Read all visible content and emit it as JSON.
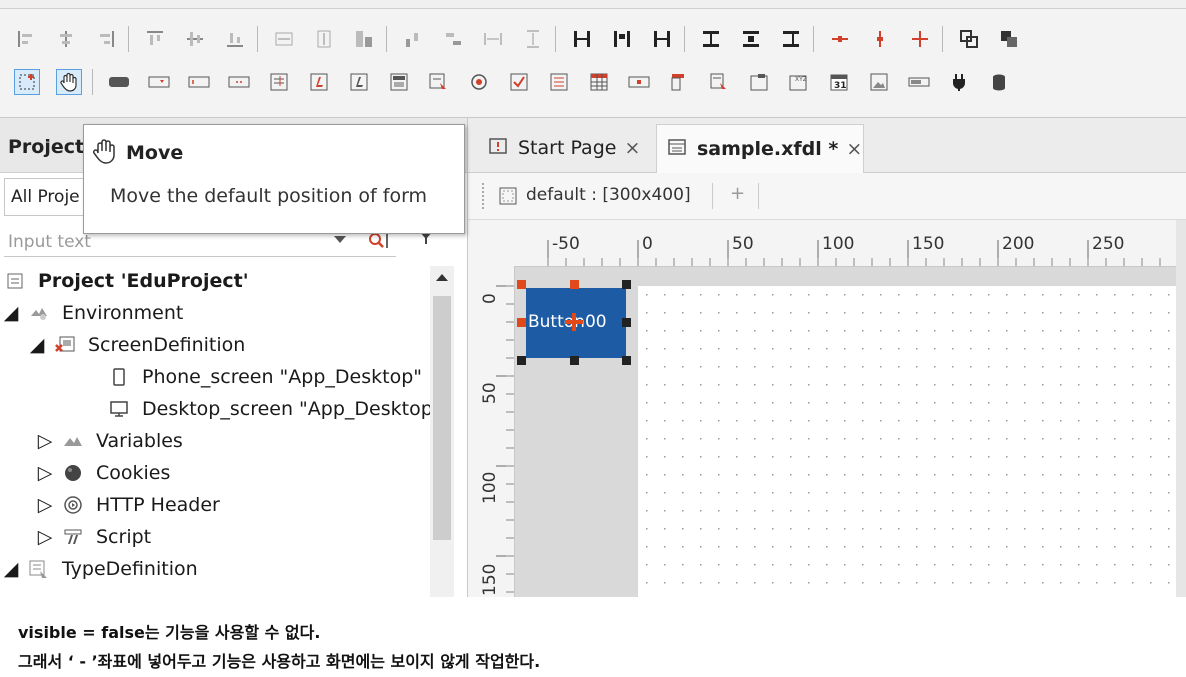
{
  "toolbar": {
    "row1_icons": [
      "align-left-icon",
      "align-center-icon",
      "align-right-icon",
      "align-top-icon",
      "align-middle-icon",
      "align-bottom-icon",
      "same-width-icon",
      "same-height-icon",
      "same-size-icon",
      "distribute-h-icon",
      "distribute-v-icon",
      "space-h-icon",
      "space-v-icon",
      "anchor-left-icon",
      "anchor-center-icon",
      "anchor-right-icon",
      "anchor-top-icon",
      "anchor-middle-icon",
      "anchor-bottom-icon",
      "shrink-h-icon",
      "grow-v-icon",
      "grow-all-icon",
      "bring-front-icon",
      "send-back-icon"
    ],
    "row2_icons": [
      "select-icon",
      "move-hand-icon",
      "button-comp-icon",
      "combo-comp-icon",
      "edit-comp-icon",
      "spin-comp-icon",
      "textarea-comp-icon",
      "label-comp-icon",
      "static-comp-icon",
      "calendar-comp-icon",
      "radio-comp-icon",
      "checkbox-comp-icon",
      "listbox-comp-icon",
      "grid-comp-icon",
      "maskedit-comp-icon",
      "menu-comp-icon",
      "tab-comp-icon",
      "div-comp-icon",
      "groupbox-comp-icon",
      "date-comp-icon",
      "image-comp-icon",
      "progress-comp-icon",
      "plugin-comp-icon",
      "dataset-comp-icon"
    ]
  },
  "project_panel": {
    "title": "Project",
    "combo_value": "All Proje",
    "search_placeholder": "Input text"
  },
  "tooltip": {
    "title": "Move",
    "description": "Move the default position of form"
  },
  "tree": [
    {
      "label": "Project 'EduProject'",
      "icon": "project-icon",
      "twisty": ""
    },
    {
      "label": "Environment",
      "icon": "environment-icon",
      "twisty": "open"
    },
    {
      "label": "ScreenDefinition",
      "icon": "screen-definition-icon",
      "twisty": "open"
    },
    {
      "label": "Phone_screen \"App_Desktop\"",
      "icon": "phone-icon",
      "twisty": ""
    },
    {
      "label": "Desktop_screen \"App_Desktop",
      "icon": "desktop-icon",
      "twisty": ""
    },
    {
      "label": "Variables",
      "icon": "variables-icon",
      "twisty": "closed"
    },
    {
      "label": "Cookies",
      "icon": "cookies-icon",
      "twisty": "closed"
    },
    {
      "label": "HTTP Header",
      "icon": "http-header-icon",
      "twisty": "closed"
    },
    {
      "label": "Script",
      "icon": "script-icon",
      "twisty": "closed"
    },
    {
      "label": "TypeDefinition",
      "icon": "type-definition-icon",
      "twisty": "open"
    }
  ],
  "editor": {
    "tabs": [
      {
        "label": "Start Page",
        "close": "×"
      },
      {
        "label": "sample.xfdl *",
        "close": "×"
      }
    ],
    "form_label": "default : [300x400]",
    "add_label": "+",
    "ruler_top": [
      "-50",
      "0",
      "50",
      "100",
      "150",
      "200",
      "250"
    ],
    "ruler_left": [
      "0",
      "50",
      "100",
      "150"
    ],
    "button_text": "Button00"
  },
  "caption": {
    "line1": "visible = false는 기능을 사용할 수 없다.",
    "line2": "그래서 ‘ - ’좌표에 넣어두고 기능은 사용하고 화면에는 보이지 않게 작업한다."
  },
  "colors": {
    "button_fill": "#1d5ca5",
    "handle_red": "#e04a1a",
    "accent_red": "#d0402a"
  }
}
